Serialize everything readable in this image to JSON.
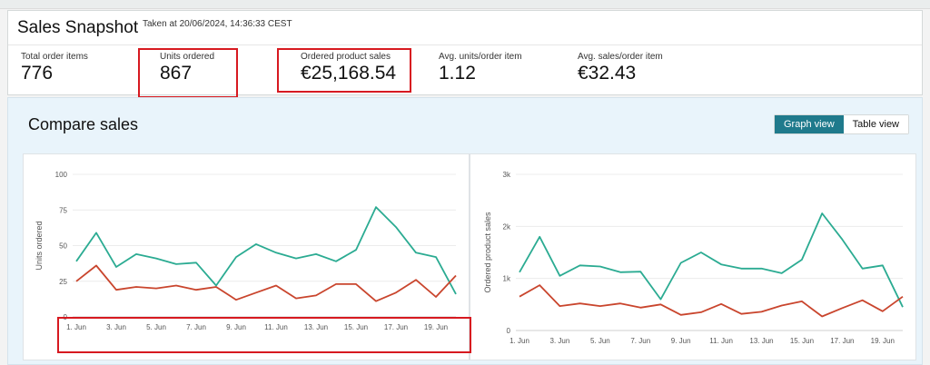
{
  "snapshot": {
    "title": "Sales Snapshot",
    "taken": "Taken at 20/06/2024, 14:36:33 CEST",
    "metrics": [
      {
        "label": "Total order items",
        "value": "776"
      },
      {
        "label": "Units ordered",
        "value": "867"
      },
      {
        "label": "Ordered product sales",
        "value": "€25,168.54"
      },
      {
        "label": "Avg. units/order item",
        "value": "1.12"
      },
      {
        "label": "Avg. sales/order item",
        "value": "€32.43"
      }
    ]
  },
  "compare": {
    "title": "Compare sales",
    "graph_view": "Graph view",
    "table_view": "Table view",
    "active_view": "graph"
  },
  "colors": {
    "teal": "#2bab92",
    "red": "#c9452d",
    "highlight": "#d71920",
    "toggle_active": "#1f7a8c"
  },
  "chart_data": [
    {
      "type": "line",
      "ylabel": "Units ordered",
      "ylim": [
        0,
        100
      ],
      "yticks": [
        "0",
        "25",
        "50",
        "75",
        "100"
      ],
      "ytick_values": [
        0,
        25,
        50,
        75,
        100
      ],
      "x": [
        "1. Jun",
        "2. Jun",
        "3. Jun",
        "4. Jun",
        "5. Jun",
        "6. Jun",
        "7. Jun",
        "8. Jun",
        "9. Jun",
        "10. Jun",
        "11. Jun",
        "12. Jun",
        "13. Jun",
        "14. Jun",
        "15. Jun",
        "16. Jun",
        "17. Jun",
        "18. Jun",
        "19. Jun",
        "20. Jun"
      ],
      "xtick_labels": [
        "1. Jun",
        "3. Jun",
        "5. Jun",
        "7. Jun",
        "9. Jun",
        "11. Jun",
        "13. Jun",
        "15. Jun",
        "17. Jun",
        "19. Jun"
      ],
      "series": [
        {
          "color": "#2bab92",
          "values": [
            39,
            59,
            35,
            44,
            41,
            37,
            38,
            22,
            42,
            51,
            45,
            41,
            44,
            39,
            47,
            77,
            63,
            45,
            42,
            16
          ]
        },
        {
          "color": "#c9452d",
          "values": [
            25,
            36,
            19,
            21,
            20,
            22,
            19,
            21,
            12,
            17,
            22,
            13,
            15,
            23,
            23,
            11,
            17,
            26,
            14,
            29
          ]
        }
      ]
    },
    {
      "type": "line",
      "ylabel": "Ordered product sales",
      "ylim": [
        0,
        3000
      ],
      "yticks": [
        "0",
        "1k",
        "2k",
        "3k"
      ],
      "ytick_values": [
        0,
        1000,
        2000,
        3000
      ],
      "x": [
        "1. Jun",
        "2. Jun",
        "3. Jun",
        "4. Jun",
        "5. Jun",
        "6. Jun",
        "7. Jun",
        "8. Jun",
        "9. Jun",
        "10. Jun",
        "11. Jun",
        "12. Jun",
        "13. Jun",
        "14. Jun",
        "15. Jun",
        "16. Jun",
        "17. Jun",
        "18. Jun",
        "19. Jun",
        "20. Jun"
      ],
      "xtick_labels": [
        "1. Jun",
        "3. Jun",
        "5. Jun",
        "7. Jun",
        "9. Jun",
        "11. Jun",
        "13. Jun",
        "15. Jun",
        "17. Jun",
        "19. Jun"
      ],
      "series": [
        {
          "color": "#2bab92",
          "values": [
            1120,
            1800,
            1050,
            1250,
            1230,
            1120,
            1130,
            600,
            1300,
            1500,
            1270,
            1190,
            1190,
            1100,
            1360,
            2250,
            1750,
            1190,
            1250,
            450
          ]
        },
        {
          "color": "#c9452d",
          "values": [
            650,
            870,
            470,
            520,
            470,
            520,
            440,
            500,
            300,
            350,
            510,
            320,
            360,
            480,
            560,
            270,
            430,
            580,
            370,
            650
          ]
        }
      ]
    }
  ]
}
